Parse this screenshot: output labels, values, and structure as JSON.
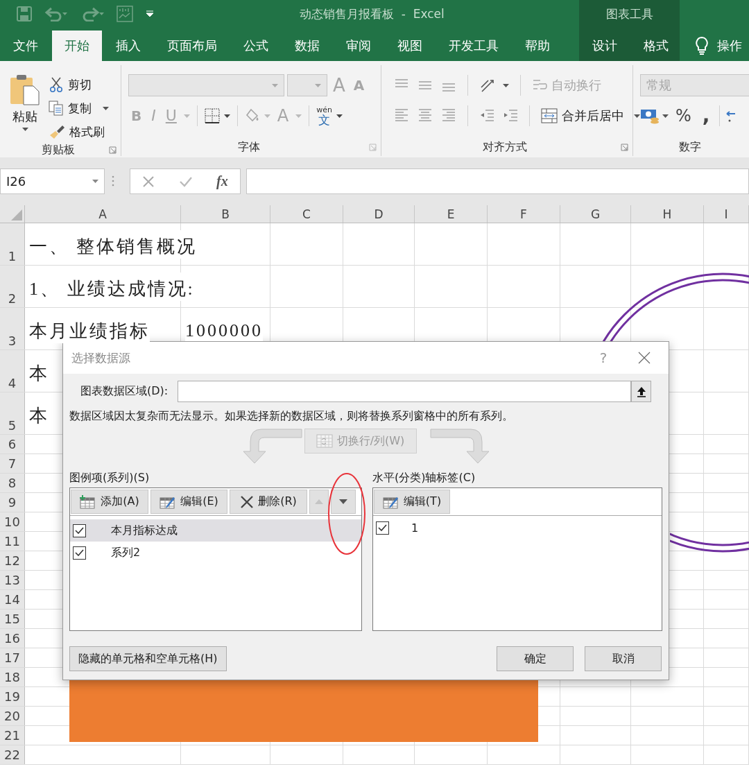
{
  "window": {
    "title": "动态销售月报看板  -  Excel",
    "context_group": "图表工具"
  },
  "tabs": [
    {
      "label": "文件",
      "selected": false,
      "contextual": false
    },
    {
      "label": "开始",
      "selected": true,
      "contextual": false
    },
    {
      "label": "插入",
      "selected": false,
      "contextual": false
    },
    {
      "label": "页面布局",
      "selected": false,
      "contextual": false
    },
    {
      "label": "公式",
      "selected": false,
      "contextual": false
    },
    {
      "label": "数据",
      "selected": false,
      "contextual": false
    },
    {
      "label": "审阅",
      "selected": false,
      "contextual": false
    },
    {
      "label": "视图",
      "selected": false,
      "contextual": false
    },
    {
      "label": "开发工具",
      "selected": false,
      "contextual": false
    },
    {
      "label": "帮助",
      "selected": false,
      "contextual": false
    },
    {
      "label": "设计",
      "selected": false,
      "contextual": true
    },
    {
      "label": "格式",
      "selected": false,
      "contextual": true
    }
  ],
  "tell_me": "操作",
  "clipboard": {
    "title": "剪贴板",
    "paste": "粘贴",
    "cut": "剪切",
    "copy": "复制",
    "format_painter": "格式刷"
  },
  "font": {
    "title": "字体",
    "disabled": true,
    "grow": "A",
    "shrink": "A",
    "bold": "B",
    "italic": "I",
    "underline": "U",
    "font_color": "A",
    "phonetic_top": "wén",
    "phonetic_bottom": "文"
  },
  "alignment": {
    "title": "对齐方式",
    "wrap": {
      "label": "自动换行",
      "disabled": true
    },
    "merge": {
      "label": "合并后居中",
      "disabled": false
    }
  },
  "number": {
    "title": "数字",
    "format": {
      "value": "常规",
      "disabled": true
    },
    "percent": "%",
    "comma": ","
  },
  "formula_bar": {
    "name_box": "I26",
    "fx": "fx"
  },
  "sheet": {
    "columns": [
      "A",
      "B",
      "C",
      "D",
      "E",
      "F",
      "G",
      "H",
      "I"
    ],
    "rows": [
      {
        "header": "1",
        "cells": [
          {
            "text": "一、 整体销售概况"
          }
        ]
      },
      {
        "header": "2",
        "cells": [
          {
            "text": "1、 业绩达成情况:"
          }
        ]
      },
      {
        "header": "3",
        "cells": [
          {
            "text": "本月业绩指标"
          },
          {
            "text": "1000000"
          }
        ]
      },
      {
        "header": "4",
        "cells": [
          {
            "text": "本"
          }
        ]
      },
      {
        "header": "5",
        "cells": [
          {
            "text": "本"
          }
        ]
      },
      {
        "header": "6"
      },
      {
        "header": "7"
      },
      {
        "header": "8"
      },
      {
        "header": "9"
      },
      {
        "header": "10"
      },
      {
        "header": "11"
      },
      {
        "header": "12"
      },
      {
        "header": "13"
      },
      {
        "header": "14"
      },
      {
        "header": "15"
      },
      {
        "header": "16"
      },
      {
        "header": "17"
      },
      {
        "header": "18"
      },
      {
        "header": "19"
      },
      {
        "header": "20"
      },
      {
        "header": "21"
      },
      {
        "header": "22"
      }
    ]
  },
  "dialog": {
    "title": "选择数据源",
    "help": "?",
    "range_label": "图表数据区域(D):",
    "message": "数据区域因太复杂而无法显示。如果选择新的数据区域，则将替换系列窗格中的所有系列。",
    "switch_button": {
      "label": "切换行/列(W)",
      "disabled": true
    },
    "series": {
      "label": "图例项(系列)(S)",
      "buttons": [
        {
          "label": "添加(A)",
          "kind": "add"
        },
        {
          "label": "编辑(E)",
          "kind": "edit"
        },
        {
          "label": "删除(R)",
          "kind": "delete"
        }
      ],
      "move_up": {
        "disabled": true
      },
      "move_down": {
        "disabled": false
      },
      "items": [
        {
          "label": "本月指标达成",
          "checked": true,
          "selected": true
        },
        {
          "label": "系列2",
          "checked": true,
          "selected": false
        }
      ]
    },
    "axis": {
      "label": "水平(分类)轴标签(C)",
      "edit_button": "编辑(T)",
      "items": [
        {
          "label": "1",
          "checked": true,
          "selected": false
        }
      ]
    },
    "hidden_cells_button": "隐藏的单元格和空单元格(H)",
    "ok": "确定",
    "cancel": "取消"
  }
}
